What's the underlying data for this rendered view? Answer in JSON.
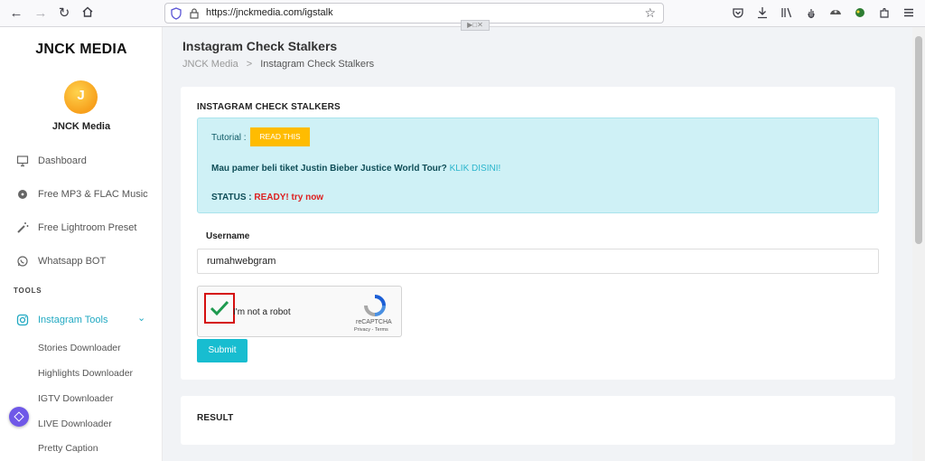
{
  "browser": {
    "url": "https://jnckmedia.com/igstalk",
    "toolbar_icons": [
      "back-arrow-icon",
      "forward-arrow-icon",
      "reload-icon",
      "home-icon",
      "pocket-icon",
      "download-icon",
      "library-icon",
      "extension-icon",
      "account-icon",
      "puzzle-icon",
      "menu-icon"
    ]
  },
  "sidebar": {
    "brand": "JNCK MEDIA",
    "profile_name": "JNCK Media",
    "items": [
      {
        "label": "Dashboard",
        "icon": "monitor-icon"
      },
      {
        "label": "Free MP3 & FLAC Music",
        "icon": "disc-icon"
      },
      {
        "label": "Free Lightroom Preset",
        "icon": "magic-wand-icon"
      },
      {
        "label": "Whatsapp BOT",
        "icon": "whatsapp-icon"
      }
    ],
    "section_label": "TOOLS",
    "active_item": {
      "label": "Instagram Tools",
      "icon": "instagram-icon"
    },
    "sub_items": [
      "Stories Downloader",
      "Highlights Downloader",
      "IGTV Downloader",
      "LIVE Downloader",
      "Pretty Caption"
    ]
  },
  "main": {
    "page_title": "Instagram Check Stalkers",
    "breadcrumb": {
      "home": "JNCK Media",
      "separator": ">",
      "current": "Instagram Check Stalkers"
    },
    "card_title": "INSTAGRAM CHECK STALKERS",
    "alert": {
      "tutorial_label": "Tutorial :",
      "read_button": "READ THIS",
      "promo_text": "Mau pamer beli tiket Justin Bieber Justice World Tour?",
      "promo_link": "KLIK DISINI!",
      "status_label": "STATUS :",
      "status_value": "READY! try now"
    },
    "username_label": "Username",
    "username_value": "rumahwebgram",
    "captcha": {
      "label": "I'm not a robot",
      "brand": "reCAPTCHA",
      "terms": "Privacy - Terms",
      "checked": true
    },
    "submit_label": "Submit",
    "result_title": "RESULT"
  },
  "colors": {
    "accent": "#18bdd0",
    "alert_bg": "#cff1f6",
    "read_button": "#ffbc00",
    "status_ready": "#dd1f1f"
  }
}
